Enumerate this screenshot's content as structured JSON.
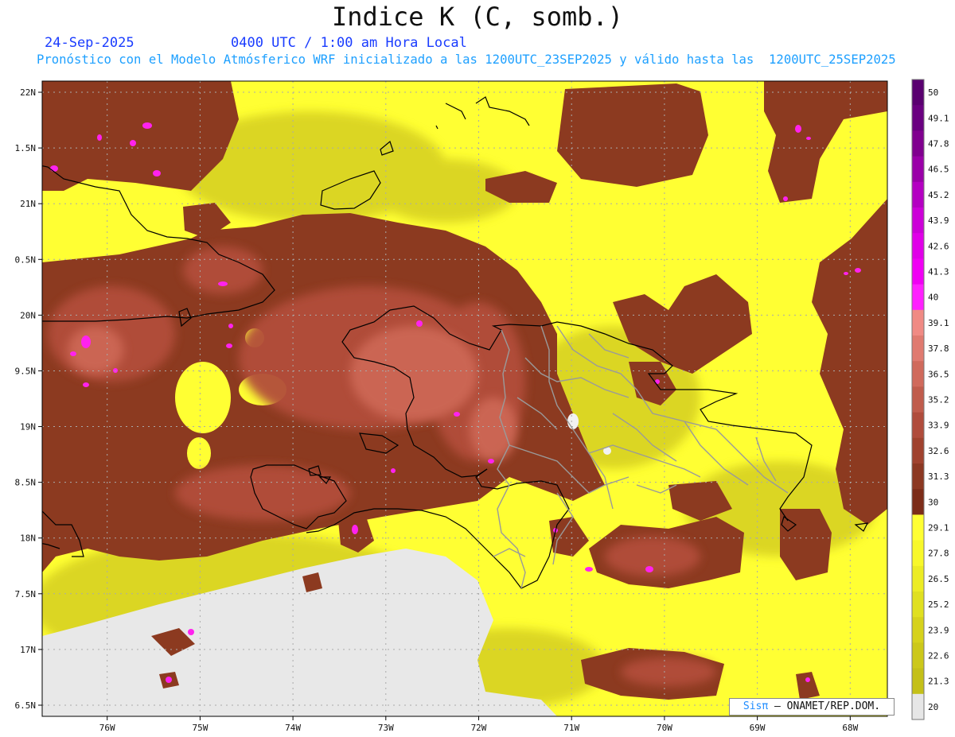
{
  "header": {
    "title": "Indice K (C, somb.)",
    "date": "24-Sep-2025",
    "time": "0400 UTC / 1:00 am Hora Local",
    "forecast": "Pronóstico con el Modelo Atmósferico WRF inicializado a las 1200UTC_23SEP2025 y válido hasta las  1200UTC_25SEP2025"
  },
  "map": {
    "lon_range": [
      -76.7,
      -67.6
    ],
    "lat_range": [
      16.4,
      22.1
    ],
    "lat_ticks": [
      {
        "value": 22.0,
        "label": "22N"
      },
      {
        "value": 21.5,
        "label": "1.5N"
      },
      {
        "value": 21.0,
        "label": "21N"
      },
      {
        "value": 20.5,
        "label": "0.5N"
      },
      {
        "value": 20.0,
        "label": "20N"
      },
      {
        "value": 19.5,
        "label": "9.5N"
      },
      {
        "value": 19.0,
        "label": "19N"
      },
      {
        "value": 18.5,
        "label": "8.5N"
      },
      {
        "value": 18.0,
        "label": "18N"
      },
      {
        "value": 17.5,
        "label": "7.5N"
      },
      {
        "value": 17.0,
        "label": "17N"
      },
      {
        "value": 16.5,
        "label": "6.5N"
      }
    ],
    "lon_ticks": [
      {
        "value": -76,
        "label": "76W"
      },
      {
        "value": -75,
        "label": "75W"
      },
      {
        "value": -74,
        "label": "74W"
      },
      {
        "value": -73,
        "label": "73W"
      },
      {
        "value": -72,
        "label": "72W"
      },
      {
        "value": -71,
        "label": "71W"
      },
      {
        "value": -70,
        "label": "70W"
      },
      {
        "value": -69,
        "label": "69W"
      },
      {
        "value": -68,
        "label": "68W"
      }
    ],
    "colors": {
      "below_20": "#e8e8e8",
      "yellow_low": "#c8c020",
      "yellow_high": "#ffff33",
      "brown": "#8c3a20",
      "brown_mid": "#b0503c",
      "brown_high": "#d06a58",
      "magenta": "#ff22ee",
      "coast": "#000000",
      "provinces": "#999999"
    }
  },
  "colorbar": {
    "labels": [
      "50",
      "49.1",
      "47.8",
      "46.5",
      "45.2",
      "43.9",
      "42.6",
      "41.3",
      "40",
      "39.1",
      "37.8",
      "36.5",
      "35.2",
      "33.9",
      "32.6",
      "31.3",
      "30",
      "29.1",
      "27.8",
      "26.5",
      "25.2",
      "23.9",
      "22.6",
      "21.3",
      "20"
    ],
    "colors": [
      "#5a0070",
      "#6a0080",
      "#80008f",
      "#9a00a8",
      "#b400c2",
      "#cc00d8",
      "#e000e8",
      "#f000f4",
      "#ff20ff",
      "#f08a84",
      "#e07a70",
      "#d06a5c",
      "#c05c4c",
      "#b04c3c",
      "#a0422e",
      "#8c3822",
      "#7c2c18",
      "#ffff33",
      "#f8f82a",
      "#ecec24",
      "#e0e020",
      "#d6d21c",
      "#ccc81a",
      "#c4c018",
      "#e6e6e6"
    ]
  },
  "credit": {
    "brand": "Sisπ",
    "text": "– ONAMET/REP.DOM."
  }
}
